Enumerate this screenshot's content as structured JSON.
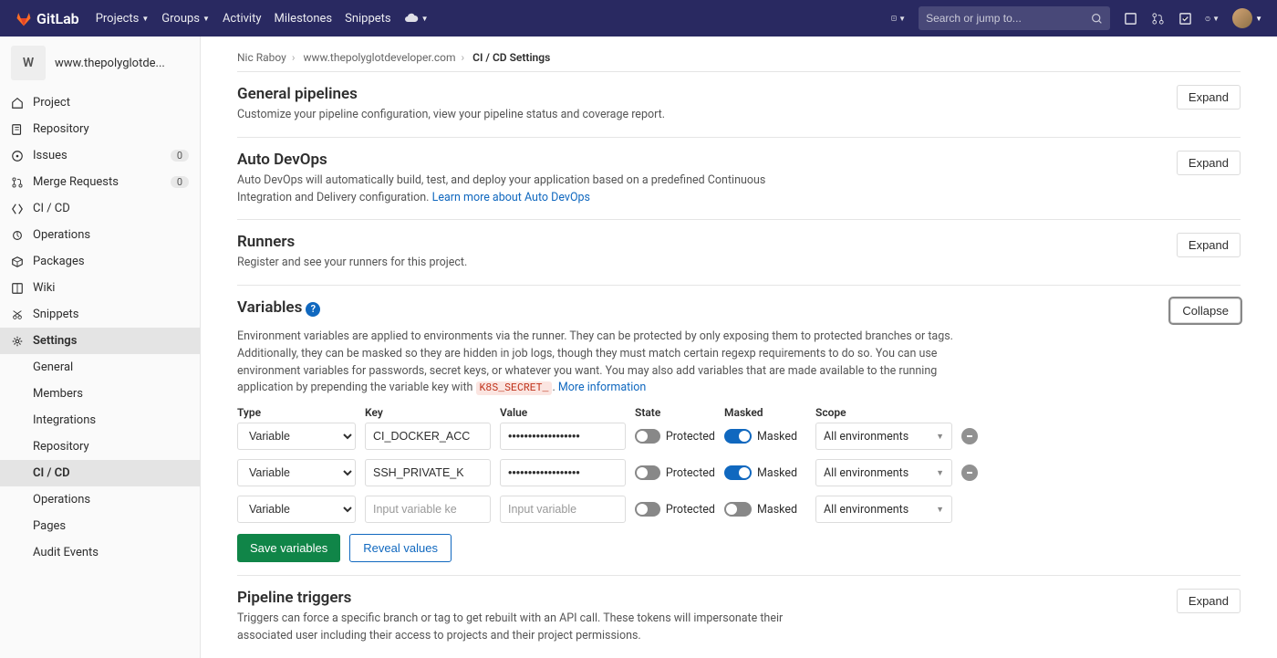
{
  "topbar": {
    "brand": "GitLab",
    "nav": [
      "Projects",
      "Groups",
      "Activity",
      "Milestones",
      "Snippets"
    ],
    "search_placeholder": "Search or jump to..."
  },
  "sidebar": {
    "project_avatar_letter": "W",
    "project_name": "www.thepolyglotde...",
    "items": [
      {
        "icon": "home",
        "label": "Project"
      },
      {
        "icon": "repo",
        "label": "Repository"
      },
      {
        "icon": "issues",
        "label": "Issues",
        "badge": "0"
      },
      {
        "icon": "merge",
        "label": "Merge Requests",
        "badge": "0"
      },
      {
        "icon": "cicd",
        "label": "CI / CD"
      },
      {
        "icon": "ops",
        "label": "Operations"
      },
      {
        "icon": "pkg",
        "label": "Packages"
      },
      {
        "icon": "wiki",
        "label": "Wiki"
      },
      {
        "icon": "snip",
        "label": "Snippets"
      },
      {
        "icon": "settings",
        "label": "Settings",
        "active": true
      }
    ],
    "sub_items": [
      "General",
      "Members",
      "Integrations",
      "Repository",
      "CI / CD",
      "Operations",
      "Pages",
      "Audit Events"
    ],
    "active_sub": "CI / CD"
  },
  "breadcrumbs": {
    "parts": [
      "Nic Raboy",
      "www.thepolyglotdeveloper.com",
      "CI / CD Settings"
    ]
  },
  "sections": {
    "general": {
      "title": "General pipelines",
      "desc": "Customize your pipeline configuration, view your pipeline status and coverage report.",
      "btn": "Expand"
    },
    "devops": {
      "title": "Auto DevOps",
      "desc": "Auto DevOps will automatically build, test, and deploy your application based on a predefined Continuous Integration and Delivery configuration. ",
      "link": "Learn more about Auto DevOps",
      "btn": "Expand"
    },
    "runners": {
      "title": "Runners",
      "desc": "Register and see your runners for this project.",
      "btn": "Expand"
    },
    "variables": {
      "title": "Variables",
      "desc": "Environment variables are applied to environments via the runner. They can be protected by only exposing them to protected branches or tags. Additionally, they can be masked so they are hidden in job logs, though they must match certain regexp requirements to do so. You can use environment variables for passwords, secret keys, or whatever you want. You may also add variables that are made available to the running application by prepending the variable key with ",
      "code": "K8S_SECRET_",
      "more_link": "More information",
      "btn": "Collapse",
      "headers": {
        "type": "Type",
        "key": "Key",
        "value": "Value",
        "state": "State",
        "masked": "Masked",
        "scope": "Scope"
      },
      "state_label": "Protected",
      "masked_label": "Masked",
      "rows": [
        {
          "type": "Variable",
          "key": "CI_DOCKER_ACC",
          "value": "••••••••••••••••••",
          "protected": false,
          "masked": true,
          "scope": "All environments"
        },
        {
          "type": "Variable",
          "key": "SSH_PRIVATE_K",
          "value": "••••••••••••••••••",
          "protected": false,
          "masked": true,
          "scope": "All environments"
        }
      ],
      "new_row": {
        "type": "Variable",
        "key_ph": "Input variable ke",
        "value_ph": "Input variable",
        "scope": "All environments"
      },
      "save_btn": "Save variables",
      "reveal_btn": "Reveal values"
    },
    "triggers": {
      "title": "Pipeline triggers",
      "desc": "Triggers can force a specific branch or tag to get rebuilt with an API call. These tokens will impersonate their associated user including their access to projects and their project permissions.",
      "btn": "Expand"
    }
  }
}
